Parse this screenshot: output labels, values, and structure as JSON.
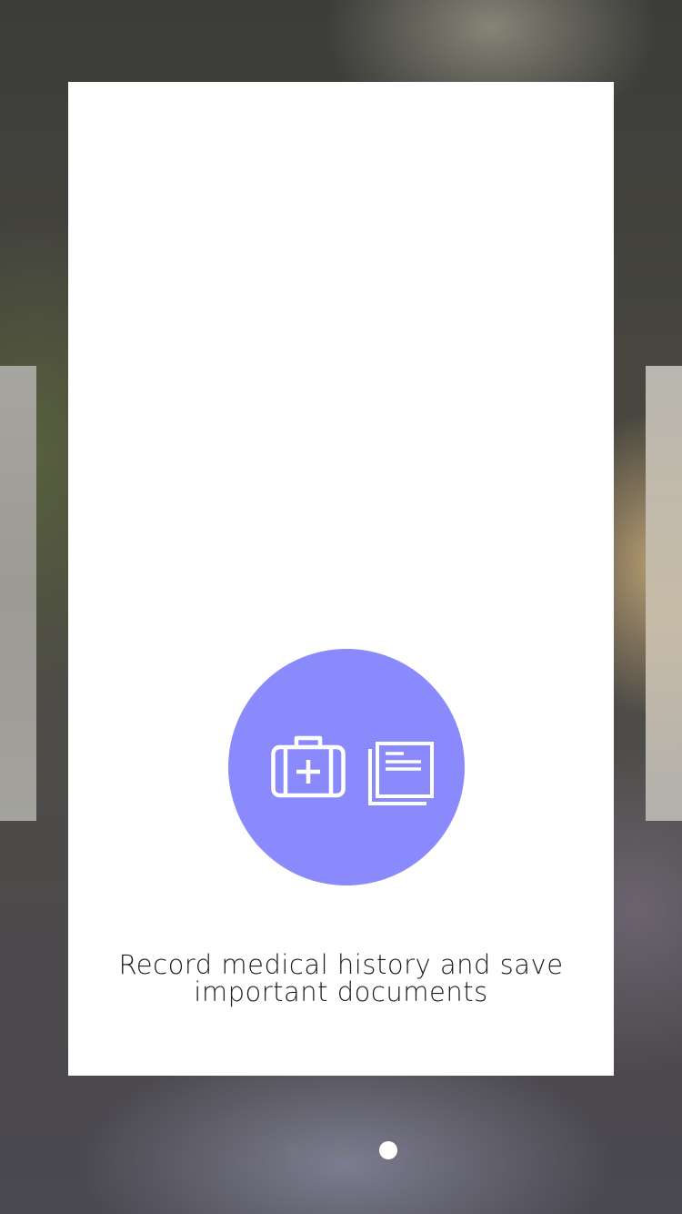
{
  "onboarding": {
    "caption_line1": "Record medical history and save",
    "caption_line2": "important documents",
    "accent_color": "#8b8afd",
    "icons": [
      "medical-kit-icon",
      "documents-icon"
    ]
  },
  "pagination": {
    "total_pages": 3,
    "current_page": 3
  }
}
